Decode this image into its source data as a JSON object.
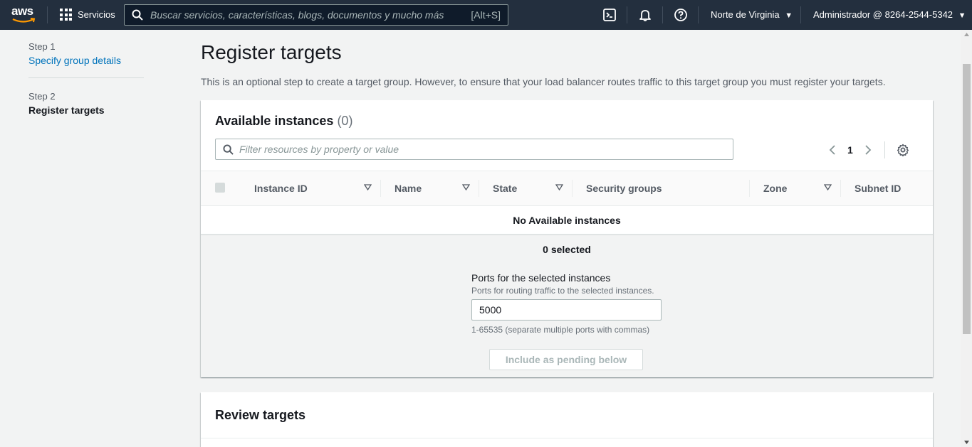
{
  "nav": {
    "logo": "aws",
    "services_label": "Servicios",
    "search_placeholder": "Buscar servicios, características, blogs, documentos y mucho más",
    "search_shortcut": "[Alt+S]",
    "region": "Norte de Virginia",
    "account": "Administrador @ 8264-2544-5342"
  },
  "steps": [
    {
      "number": "Step 1",
      "label": "Specify group details"
    },
    {
      "number": "Step 2",
      "label": "Register targets"
    }
  ],
  "page": {
    "title": "Register targets",
    "description": "This is an optional step to create a target group. However, to ensure that your load balancer routes traffic to this target group you must register your targets."
  },
  "available": {
    "title": "Available instances",
    "count": "(0)",
    "filter_placeholder": "Filter resources by property or value",
    "page_number": "1",
    "columns": [
      "Instance ID",
      "Name",
      "State",
      "Security groups",
      "Zone",
      "Subnet ID"
    ],
    "empty_message": "No Available instances",
    "selected_count": "0 selected",
    "ports_label": "Ports for the selected instances",
    "ports_description": "Ports for routing traffic to the selected instances.",
    "ports_value": "5000",
    "ports_hint": "1-65535 (separate multiple ports with commas)",
    "pending_button": "Include as pending below"
  },
  "review": {
    "title": "Review targets"
  },
  "colors": {
    "nav_bg": "#232f3e",
    "link": "#0073bb",
    "page_bg": "#f2f3f3"
  }
}
